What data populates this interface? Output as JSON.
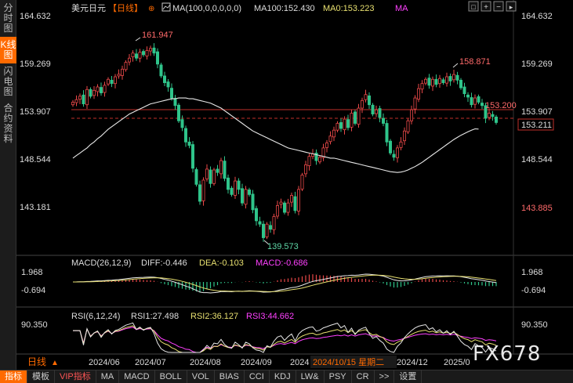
{
  "sidebar": {
    "tabs": [
      {
        "label": "分时图",
        "active": false
      },
      {
        "label": "K线图",
        "active": true
      },
      {
        "label": "闪电图",
        "active": false
      },
      {
        "label": "合约资料",
        "active": false
      }
    ]
  },
  "header": {
    "symbol": "美元日元",
    "period": "【日线】",
    "ma_label": "MA(100,0,0,0,0,0)",
    "ma100": "MA100:152.430",
    "ma0": "MA0:153.223",
    "ma_tail": "MA"
  },
  "nav_buttons": [
    "□",
    "+",
    "−",
    "▸"
  ],
  "main_axis": {
    "ticks": [
      "164.632",
      "159.269",
      "153.907",
      "148.544",
      "143.181"
    ],
    "hline_label": "153.907",
    "last_price_label": "153.211",
    "low_price_label": "143.885"
  },
  "annotations": {
    "high1": "161.947",
    "high2": "158.871",
    "low1": "139.573",
    "current": "153.200"
  },
  "macd": {
    "title": "MACD(26,12,9)",
    "diff": "DIFF:-0.446",
    "dea": "DEA:-0.103",
    "macd": "MACD:-0.686",
    "tick_top": "1.968",
    "tick_bottom": "-0.694"
  },
  "rsi": {
    "title": "RSI(6,12,24)",
    "rsi1": "RSI1:27.498",
    "rsi2": "RSI2:36.127",
    "rsi3": "RSI3:44.662",
    "tick_top": "90.350"
  },
  "time_axis": {
    "period_label": "日线",
    "months": [
      "2024/06",
      "2024/07",
      "2024/08",
      "2024/09",
      "2024",
      "2024/12",
      "2025/0"
    ],
    "cursor_date": "2024/10/15 星期二"
  },
  "bottom_tabs": [
    {
      "label": "指标",
      "active": true
    },
    {
      "label": "模板"
    },
    {
      "label": "VIP指标",
      "vip": true
    },
    {
      "label": "MA"
    },
    {
      "label": "MACD"
    },
    {
      "label": "BOLL"
    },
    {
      "label": "VOL"
    },
    {
      "label": "BIAS"
    },
    {
      "label": "CCI"
    },
    {
      "label": "KDJ"
    },
    {
      "label": "LW&"
    },
    {
      "label": "PSY"
    },
    {
      "label": "CR"
    },
    {
      "label": ">>"
    },
    {
      "label": "设置"
    }
  ],
  "watermark": "FX678",
  "colors": {
    "up": "#e84848",
    "down": "#2fc48a",
    "ma100": "#e8e8e8",
    "diff": "#e8e8e8",
    "dea": "#e8e070",
    "macd": "#ff40ff",
    "rsi1": "#e8e8e8",
    "rsi2": "#e8e070",
    "rsi3": "#ff40ff"
  },
  "chart_data": {
    "type": "candlestick",
    "symbol": "USD/JPY",
    "period": "daily",
    "ylim": [
      139.0,
      166.0
    ],
    "y_ticks": [
      164.632,
      159.269,
      153.907,
      148.544,
      143.181
    ],
    "x_labels": [
      "2024/06",
      "2024/07",
      "2024/08",
      "2024/09",
      "2024",
      "2024/12",
      "2025/0"
    ],
    "close": [
      155.6,
      155.9,
      156.3,
      155.4,
      157.1,
      156.3,
      157.0,
      157.4,
      156.7,
      157.6,
      158.3,
      157.8,
      158.6,
      158.9,
      159.5,
      160.3,
      160.8,
      161.4,
      160.8,
      161.5,
      161.2,
      161.7,
      161.95,
      161.4,
      160.1,
      158.7,
      157.9,
      157.4,
      156.1,
      155.2,
      153.4,
      152.6,
      150.9,
      150.5,
      147.8,
      145.9,
      143.9,
      146.4,
      147.7,
      146.0,
      147.6,
      147.3,
      148.7,
      146.6,
      145.3,
      144.7,
      146.3,
      145.3,
      143.7,
      145.3,
      144.7,
      142.9,
      141.6,
      141.2,
      139.6,
      141.2,
      140.6,
      142.1,
      143.4,
      143.8,
      142.6,
      143.7,
      144.6,
      142.8,
      145.3,
      147.0,
      148.2,
      149.2,
      149.5,
      148.7,
      149.1,
      150.2,
      150.8,
      151.6,
      152.3,
      153.1,
      152.5,
      153.6,
      152.6,
      154.3,
      153.1,
      154.9,
      155.8,
      156.5,
      155.3,
      154.2,
      154.7,
      153.8,
      153.1,
      150.9,
      149.6,
      149.1,
      150.2,
      150.9,
      152.2,
      153.4,
      154.7,
      156.1,
      157.2,
      157.8,
      158.3,
      157.6,
      158.3,
      157.7,
      158.4,
      157.9,
      158.6,
      158.1,
      158.87,
      158.2,
      157.3,
      156.6,
      156.2,
      155.3,
      156.1,
      155.6,
      155.2,
      153.7,
      154.3,
      153.9,
      153.2
    ],
    "ma100": [
      149.0,
      149.3,
      149.6,
      149.9,
      150.2,
      150.6,
      150.9,
      151.3,
      151.6,
      152.0,
      152.4,
      152.7,
      153.0,
      153.3,
      153.6,
      153.9,
      154.2,
      154.4,
      154.6,
      154.8,
      155.0,
      155.2,
      155.4,
      155.5,
      155.6,
      155.7,
      155.8,
      155.9,
      156.0,
      156.0,
      156.1,
      156.1,
      156.1,
      156.0,
      156.0,
      155.9,
      155.8,
      155.7,
      155.6,
      155.5,
      155.3,
      155.1,
      154.9,
      154.6,
      154.3,
      154.0,
      153.7,
      153.4,
      153.1,
      152.8,
      152.5,
      152.2,
      152.0,
      151.8,
      151.6,
      151.4,
      151.2,
      151.0,
      150.8,
      150.6,
      150.4,
      150.2,
      150.1,
      150.0,
      149.9,
      149.8,
      149.7,
      149.6,
      149.5,
      149.4,
      149.3,
      149.2,
      149.1,
      149.0,
      149.0,
      148.9,
      148.8,
      148.7,
      148.6,
      148.5,
      148.4,
      148.3,
      148.2,
      148.1,
      148.0,
      147.9,
      147.8,
      147.7,
      147.6,
      147.5,
      147.4,
      147.35,
      147.3,
      147.35,
      147.45,
      147.6,
      147.8,
      148.0,
      148.25,
      148.5,
      148.8,
      149.1,
      149.4,
      149.7,
      150.0,
      150.3,
      150.6,
      150.9,
      151.2,
      151.45,
      151.7,
      151.9,
      152.1,
      152.3,
      152.45,
      152.43
    ],
    "macd_series": {
      "diff_last": -0.446,
      "dea_last": -0.103,
      "macd_last": -0.686,
      "y_ticks": [
        1.968,
        -0.694
      ]
    },
    "rsi_series": {
      "rsi1_last": 27.498,
      "rsi2_last": 36.127,
      "rsi3_last": 44.662,
      "y_ticks": [
        90.35
      ]
    },
    "annotations": [
      {
        "label": "161.947",
        "type": "high"
      },
      {
        "label": "158.871",
        "type": "high"
      },
      {
        "label": "139.573",
        "type": "low"
      },
      {
        "label": "153.200",
        "type": "current"
      }
    ]
  }
}
